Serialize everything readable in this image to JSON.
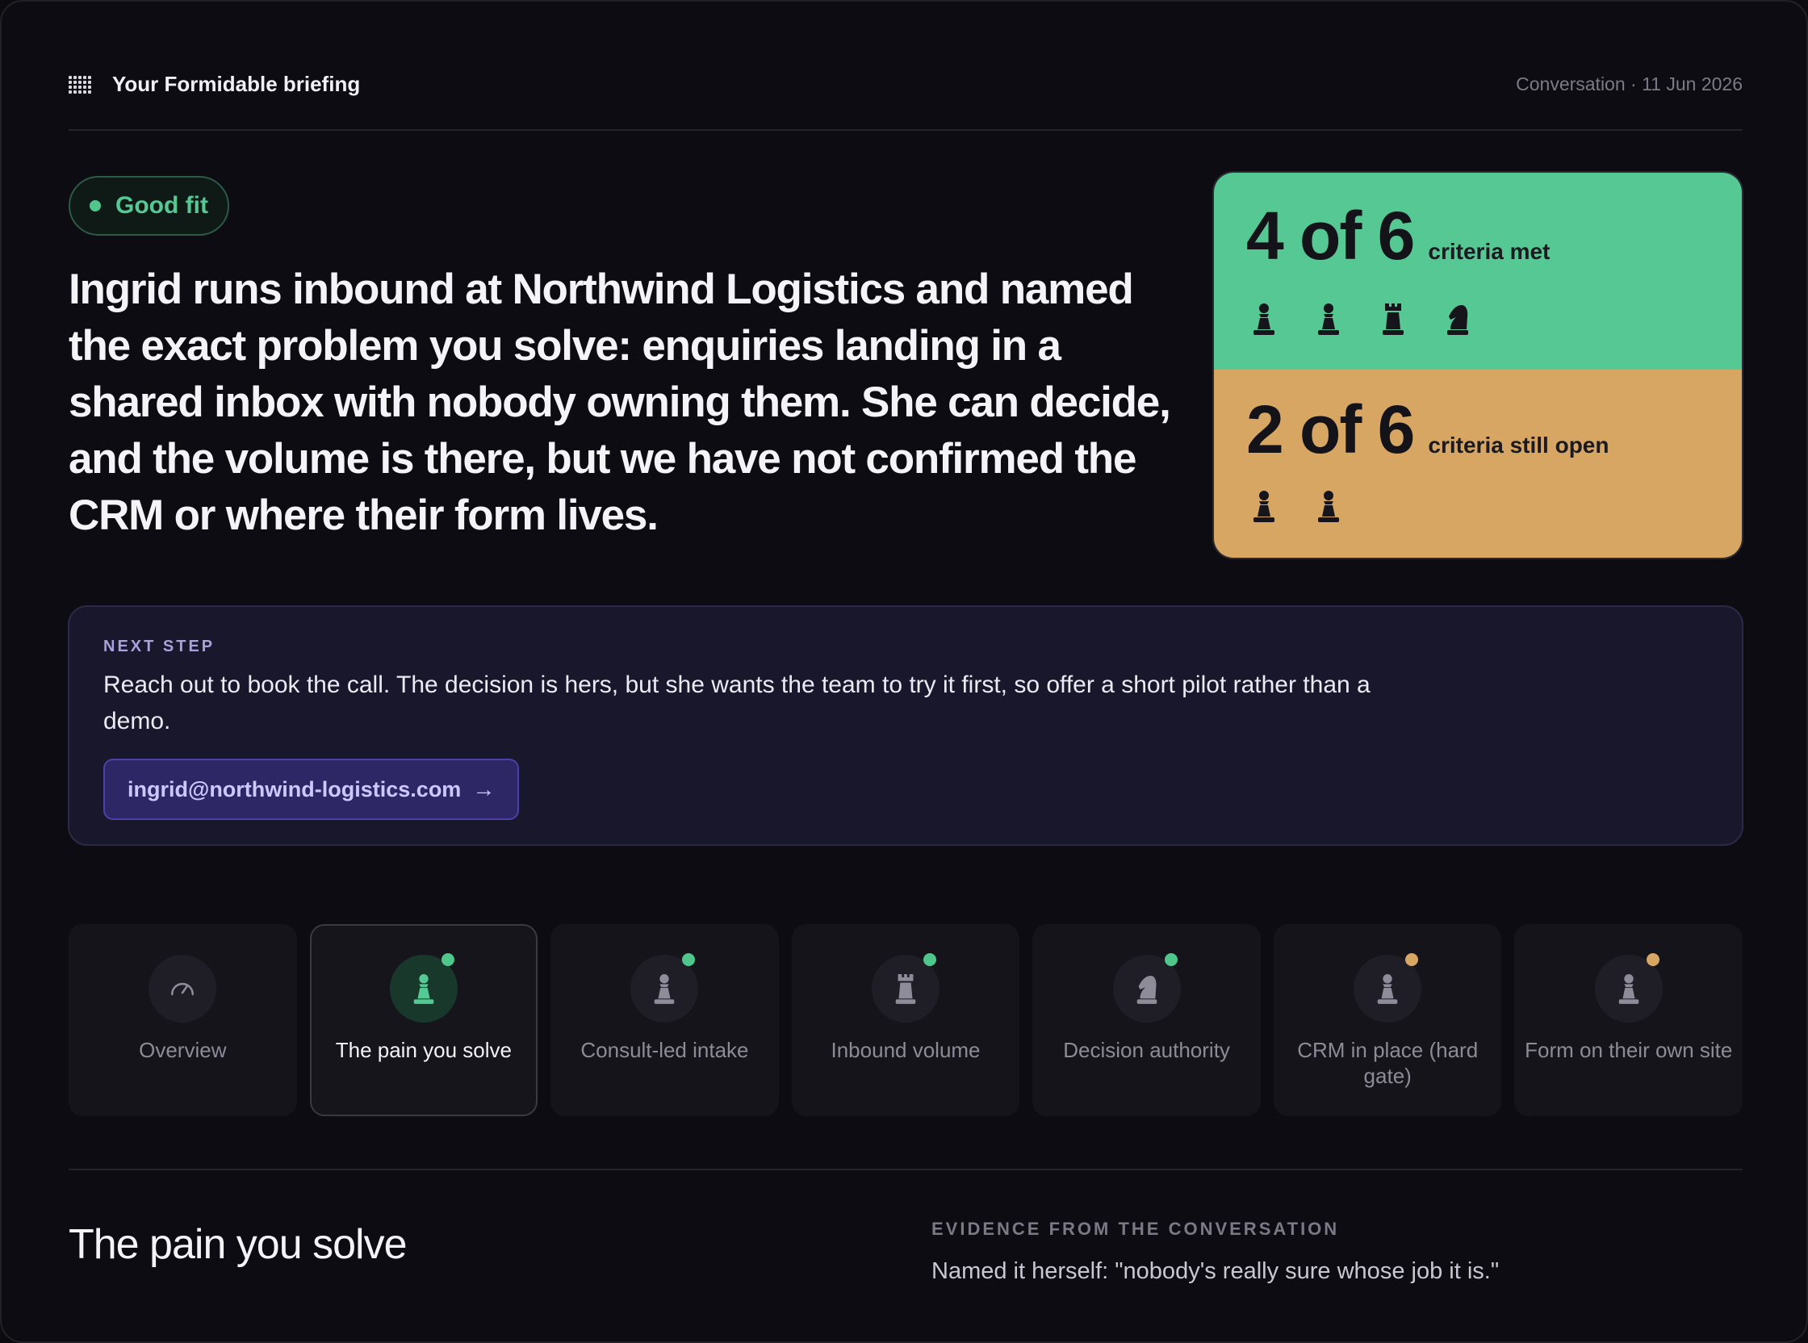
{
  "header": {
    "icon": "grid-icon",
    "title": "Your Formidable briefing",
    "meta": "Conversation · 11 Jun 2026"
  },
  "hero": {
    "fit_badge": "Good fit",
    "fit_color": "#55c993",
    "summary": "Ingrid runs inbound at Northwind Logistics and named the exact problem you solve: enquiries landing in a shared inbox with nobody owning them. She can decide, and the volume is there, but we have not confirmed the CRM or where their form lives."
  },
  "criteria": {
    "met": {
      "count": "4 of 6",
      "label": "criteria met",
      "color": "#55c893",
      "pieces": [
        "pawn-icon",
        "pawn-icon",
        "rook-icon",
        "knight-icon"
      ]
    },
    "open": {
      "count": "2 of 6",
      "label": "criteria still open",
      "color": "#d7a662",
      "pieces": [
        "pawn-icon",
        "pawn-icon"
      ]
    }
  },
  "next_step": {
    "label": "NEXT STEP",
    "text": "Reach out to book the call. The decision is hers, but she wants the team to try it first, so offer a short pilot rather than a demo.",
    "email": "ingrid@northwind-logistics.com",
    "arrow": "→"
  },
  "tabs": [
    {
      "label": "Overview",
      "icon": "gauge-icon",
      "status": null
    },
    {
      "label": "The pain you solve",
      "icon": "pawn-icon",
      "status": "met",
      "active": true
    },
    {
      "label": "Consult-led intake",
      "icon": "pawn-icon",
      "status": "met"
    },
    {
      "label": "Inbound volume",
      "icon": "rook-icon",
      "status": "met"
    },
    {
      "label": "Decision authority",
      "icon": "knight-icon",
      "status": "met"
    },
    {
      "label": "CRM in place (hard gate)",
      "icon": "pawn-icon",
      "status": "open"
    },
    {
      "label": "Form on their own site",
      "icon": "pawn-icon",
      "status": "open"
    }
  ],
  "status_colors": {
    "met": "#4fc68b",
    "open": "#d7a662"
  },
  "detail": {
    "title": "The pain you solve",
    "evidence_label": "EVIDENCE FROM THE CONVERSATION",
    "evidence_text": "Named it herself: \"nobody's really sure whose job it is.\""
  }
}
